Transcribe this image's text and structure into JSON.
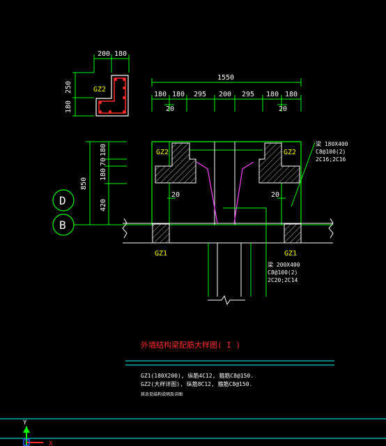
{
  "drawing": {
    "section_labels": {
      "gz2_inset": "GZ2",
      "gz2_left": "GZ2",
      "gz2_right": "GZ2",
      "gz1_left": "GZ1",
      "gz1_right": "GZ1"
    },
    "inset_dims": {
      "top_a": "200",
      "top_b": "180",
      "side_a": "250",
      "side_b": "180"
    },
    "top_dims": {
      "total": "1550",
      "segments": [
        "180",
        "180",
        "295",
        "200",
        "295",
        "180",
        "180"
      ],
      "sub_left": "20",
      "sub_right": "20"
    },
    "left_dims": {
      "total": "850",
      "segments": [
        "180",
        "70",
        "180",
        "420"
      ]
    },
    "mid_dims": {
      "left": "20",
      "right": "20"
    },
    "grid_axes": [
      "D",
      "B"
    ],
    "beam_note_upper": [
      "梁 180X400",
      "C8@100(2)",
      "2C16;2C16"
    ],
    "beam_note_lower": [
      "梁 200X400",
      "C8@100(2)",
      "2C20;2C14"
    ],
    "title": "外墙结构梁配筋大样图( I )",
    "notes": [
      "GZ1(180X200), 纵筋4C12, 箍筋C8@150.",
      "GZ2(大样详图), 纵筋8C12, 箍筋C8@150.",
      "其余见结构说明及详图"
    ],
    "ucs": {
      "y_label": "Y",
      "x_label": "X"
    }
  },
  "colors": {
    "background": "#000000",
    "dim_line": "#00ff00",
    "label": "#ffff00",
    "title": "#ff2a2a",
    "cyan": "#00ffff",
    "magenta": "#ff44ff",
    "white": "#ffffff"
  }
}
